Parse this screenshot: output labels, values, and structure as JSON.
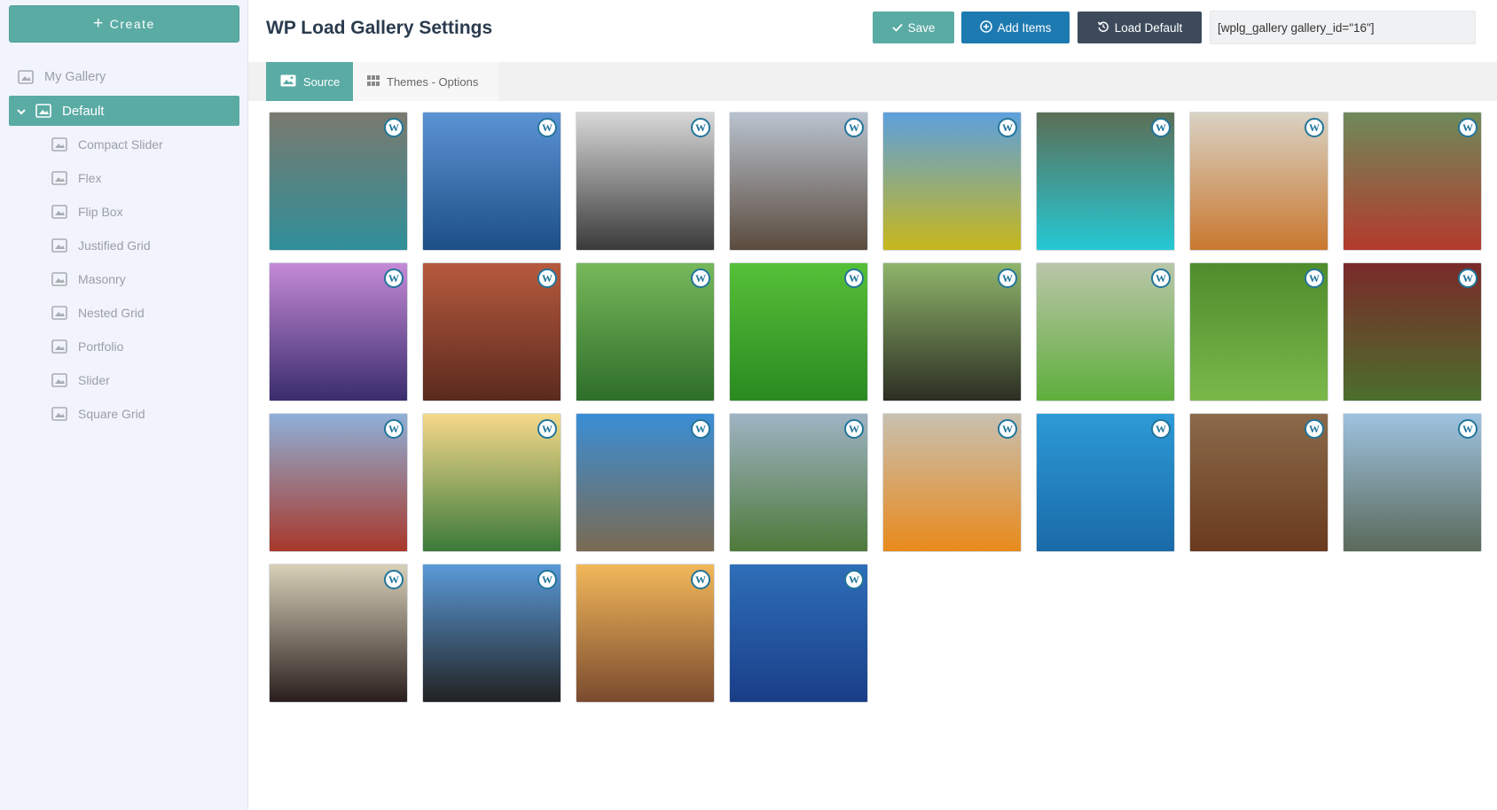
{
  "sidebar": {
    "create_label": "Create",
    "tree": [
      {
        "label": "My Gallery",
        "level": "root",
        "active": false
      },
      {
        "label": "Default",
        "level": "root",
        "active": true
      },
      {
        "label": "Compact Slider",
        "level": "child"
      },
      {
        "label": "Flex",
        "level": "child"
      },
      {
        "label": "Flip Box",
        "level": "child"
      },
      {
        "label": "Justified Grid",
        "level": "child"
      },
      {
        "label": "Masonry",
        "level": "child"
      },
      {
        "label": "Nested Grid",
        "level": "child"
      },
      {
        "label": "Portfolio",
        "level": "child"
      },
      {
        "label": "Slider",
        "level": "child"
      },
      {
        "label": "Square Grid",
        "level": "child"
      }
    ]
  },
  "header": {
    "title": "WP Load Gallery Settings",
    "save_label": "Save",
    "add_label": "Add Items",
    "load_label": "Load Default",
    "shortcode": "[wplg_gallery gallery_id=\"16\"]"
  },
  "tabs": [
    {
      "label": "Source",
      "active": true
    },
    {
      "label": "Themes - Options",
      "active": false
    }
  ],
  "gallery": {
    "badge_icon": "wordpress-icon",
    "items": [
      {
        "subject": "coastal waterfall cove",
        "colors": [
          "#7a7a6e",
          "#2f8f9a"
        ]
      },
      {
        "subject": "wooden pier over blue water",
        "colors": [
          "#5c93d4",
          "#1c4f86"
        ]
      },
      {
        "subject": "black and white macro",
        "colors": [
          "#d8d8d8",
          "#3a3a3a"
        ]
      },
      {
        "subject": "sunset rocky beach arch",
        "colors": [
          "#b9c3cf",
          "#5b4b3e"
        ]
      },
      {
        "subject": "yellow rapeseed field",
        "colors": [
          "#5da0de",
          "#c8b71c"
        ]
      },
      {
        "subject": "turquoise lagoon with kayak",
        "colors": [
          "#5c6e55",
          "#25c8d4"
        ]
      },
      {
        "subject": "woman in golden field",
        "colors": [
          "#d9d2c4",
          "#c9782f"
        ]
      },
      {
        "subject": "colorful harbor houses",
        "colors": [
          "#6f8a5a",
          "#b33a2c"
        ]
      },
      {
        "subject": "purple misty lake trees",
        "colors": [
          "#c48ad6",
          "#3a2c6e"
        ]
      },
      {
        "subject": "red bark macro",
        "colors": [
          "#b75a3e",
          "#5a2a1e"
        ]
      },
      {
        "subject": "green fern macro",
        "colors": [
          "#76b85a",
          "#2e6e2a"
        ]
      },
      {
        "subject": "water drops on leaf",
        "colors": [
          "#56c038",
          "#2a8a20"
        ]
      },
      {
        "subject": "crop rows field",
        "colors": [
          "#8fb56c",
          "#2c2e22"
        ]
      },
      {
        "subject": "green forest grass",
        "colors": [
          "#b9c6a8",
          "#5fae3c"
        ]
      },
      {
        "subject": "pine needles",
        "colors": [
          "#4f8c2c",
          "#7bb84a"
        ]
      },
      {
        "subject": "red spiky plant",
        "colors": [
          "#7a2a2a",
          "#4c6e2c"
        ]
      },
      {
        "subject": "golden gate bridge",
        "colors": [
          "#8fb0d8",
          "#a8382a"
        ]
      },
      {
        "subject": "sunset coastal hills",
        "colors": [
          "#f6d98a",
          "#3b7a3a"
        ]
      },
      {
        "subject": "rocky sea stack waves",
        "colors": [
          "#3a8ed6",
          "#7a6a52"
        ]
      },
      {
        "subject": "valley rice terraces",
        "colors": [
          "#9fb3c4",
          "#4e7a3a"
        ]
      },
      {
        "subject": "orange lily flower",
        "colors": [
          "#c8c0b0",
          "#e88a1c"
        ]
      },
      {
        "subject": "rain drops on water",
        "colors": [
          "#2c9ad6",
          "#1a6aa8"
        ]
      },
      {
        "subject": "rusty rail track",
        "colors": [
          "#8a6a4a",
          "#6a3a1e"
        ]
      },
      {
        "subject": "calm sea horizon",
        "colors": [
          "#9ec2e0",
          "#5a6a5a"
        ]
      },
      {
        "subject": "sun rays through trees",
        "colors": [
          "#d8d0b8",
          "#2a1e1e"
        ]
      },
      {
        "subject": "harbour bridge arch",
        "colors": [
          "#5a9ad8",
          "#222222"
        ]
      },
      {
        "subject": "couple at sunset",
        "colors": [
          "#f2b85a",
          "#7a4a2e"
        ]
      },
      {
        "subject": "marina blue reflections",
        "colors": [
          "#2e6eb8",
          "#1a3e88"
        ]
      }
    ]
  }
}
